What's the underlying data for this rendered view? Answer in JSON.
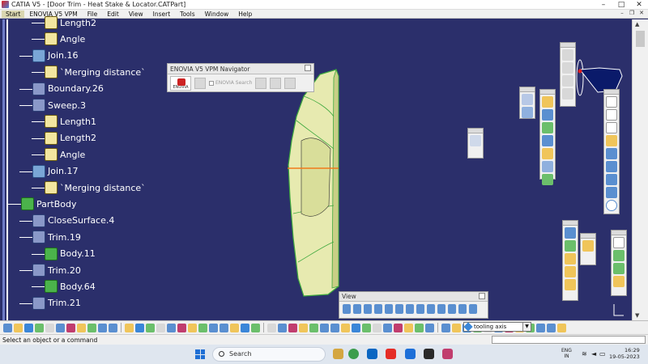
{
  "window": {
    "title": "CATIA V5 - [Door Trim - Heat Stake & Locator.CATPart]",
    "minimize": "–",
    "maximize": "□",
    "close": "✕"
  },
  "menu": {
    "items": [
      "Start",
      "ENOVIA V5 VPM",
      "File",
      "Edit",
      "View",
      "Insert",
      "Tools",
      "Window",
      "Help"
    ],
    "mdi_minimize": "–",
    "mdi_restore": "❐",
    "mdi_close": "✕"
  },
  "tree": {
    "items": [
      {
        "label": "Length2",
        "icon": "parameter-icon"
      },
      {
        "label": "Angle",
        "icon": "parameter-icon"
      },
      {
        "label": "Join.16",
        "icon": "join-icon"
      },
      {
        "label": "`Merging distance`",
        "icon": "parameter-icon"
      },
      {
        "label": "Boundary.26",
        "icon": "boundary-icon"
      },
      {
        "label": "Sweep.3",
        "icon": "sweep-icon"
      },
      {
        "label": "Length1",
        "icon": "parameter-icon"
      },
      {
        "label": "Length2",
        "icon": "parameter-icon"
      },
      {
        "label": "Angle",
        "icon": "parameter-icon"
      },
      {
        "label": "Join.17",
        "icon": "join-icon"
      },
      {
        "label": "`Merging distance`",
        "icon": "parameter-icon"
      },
      {
        "label": "PartBody",
        "icon": "partbody-icon"
      },
      {
        "label": "CloseSurface.4",
        "icon": "closesurface-icon"
      },
      {
        "label": "Trim.19",
        "icon": "trim-icon"
      },
      {
        "label": "Body.11",
        "icon": "body-icon"
      },
      {
        "label": "Trim.20",
        "icon": "trim-icon"
      },
      {
        "label": "Body.64",
        "icon": "body-icon"
      },
      {
        "label": "Trim.21",
        "icon": "trim-icon"
      }
    ]
  },
  "navigator": {
    "title": "ENOVIA V5 VPM Navigator",
    "logo_text": "ENOVIA",
    "search_label": "ENOVIA Search"
  },
  "view_toolbar": {
    "title": "View"
  },
  "command": {
    "selected": "tooling axis",
    "dropdown_arrow": "▼"
  },
  "status": {
    "prompt": "Select an object or a command"
  },
  "taskbar": {
    "search_placeholder": "Search",
    "lang_line1": "ENG",
    "lang_line2": "IN",
    "time": "16:29",
    "date": "19-05-2023"
  },
  "colors": {
    "viewport_bg": "#2b2f6b",
    "part_fill": "#e7eab0",
    "part_edge": "#3da83d",
    "axis_orange": "#f07a1a"
  }
}
